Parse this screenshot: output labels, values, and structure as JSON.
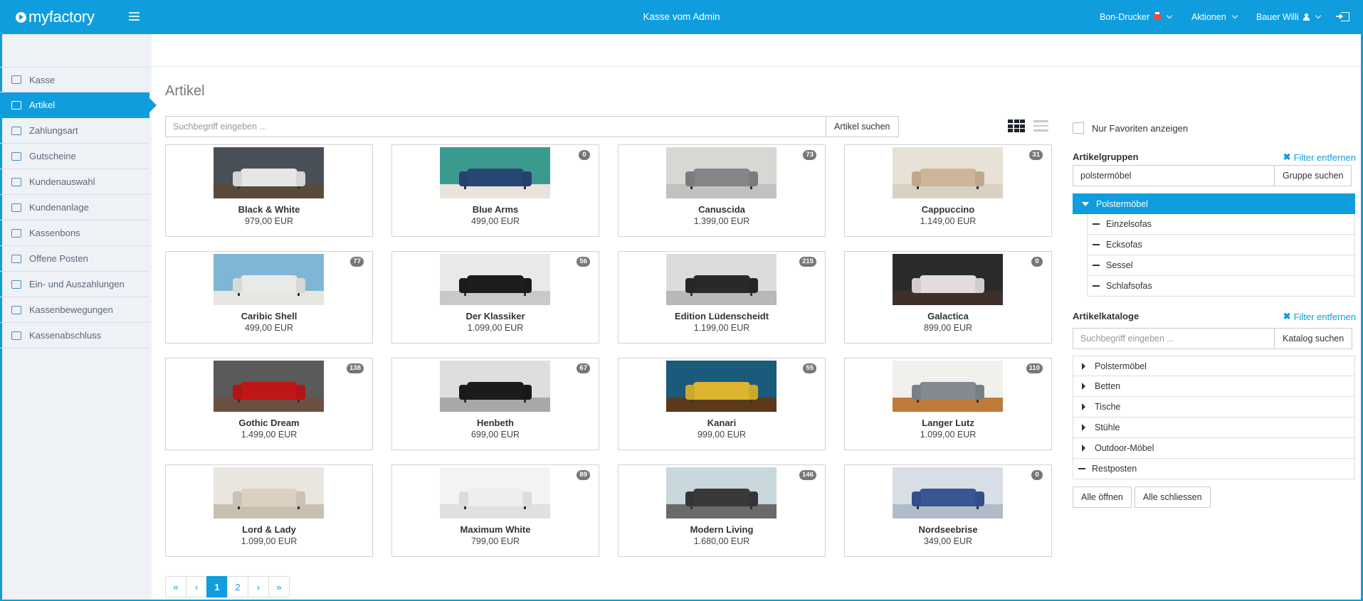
{
  "header": {
    "logo_text": "myfactory",
    "title": "Kasse vom Admin",
    "printer_label": "Bon-Drucker",
    "actions_label": "Aktionen",
    "user_label": "Bauer Willi"
  },
  "sidebar": {
    "items": [
      {
        "label": "Kasse",
        "icon": "cart-icon"
      },
      {
        "label": "Artikel",
        "icon": "tag-icon",
        "active": true
      },
      {
        "label": "Zahlungsart",
        "icon": "wallet-icon"
      },
      {
        "label": "Gutscheine",
        "icon": "gift-icon"
      },
      {
        "label": "Kundenauswahl",
        "icon": "user-icon"
      },
      {
        "label": "Kundenanlage",
        "icon": "user-add-icon"
      },
      {
        "label": "Kassenbons",
        "icon": "receipt-icon"
      },
      {
        "label": "Offene Posten",
        "icon": "book-icon"
      },
      {
        "label": "Ein- und Auszahlungen",
        "icon": "inbox-icon"
      },
      {
        "label": "Kassenbewegungen",
        "icon": "list-icon"
      },
      {
        "label": "Kassenabschluss",
        "icon": "calculator-icon"
      }
    ]
  },
  "main": {
    "title": "Artikel",
    "search_placeholder": "Suchbegriff eingeben ...",
    "search_button": "Artikel suchen",
    "products": [
      {
        "name": "Black & White",
        "price": "979,00 EUR",
        "badge": "",
        "wall": "#4a5058",
        "floor": "#5a4a3a",
        "sofa": "#f2f2f2"
      },
      {
        "name": "Blue Arms",
        "price": "499,00 EUR",
        "badge": "0",
        "wall": "#3a9a8e",
        "floor": "#e8e4dc",
        "sofa": "#2a4a7a"
      },
      {
        "name": "Canuscida",
        "price": "1.399,00 EUR",
        "badge": "73",
        "wall": "#d6d8d4",
        "floor": "#bfc2bf",
        "sofa": "#8a8c8e"
      },
      {
        "name": "Cappuccino",
        "price": "1.149,00 EUR",
        "badge": "31",
        "wall": "#e8e2d6",
        "floor": "#d9d1c3",
        "sofa": "#d8c0a0"
      },
      {
        "name": "Caribic Shell",
        "price": "499,00 EUR",
        "badge": "77",
        "wall": "#7fb6d6",
        "floor": "#e8e6e0",
        "sofa": "#f5f5f3"
      },
      {
        "name": "Der Klassiker",
        "price": "1.099,00 EUR",
        "badge": "56",
        "wall": "#e9e9e9",
        "floor": "#c9c9c9",
        "sofa": "#1f1f1f"
      },
      {
        "name": "Edition Lüdenscheidt",
        "price": "1.199,00 EUR",
        "badge": "215",
        "wall": "#dcdcdc",
        "floor": "#b8b8b8",
        "sofa": "#2b2b2b"
      },
      {
        "name": "Galactica",
        "price": "899,00 EUR",
        "badge": "0",
        "wall": "#2a2a2a",
        "floor": "#3d2f2a",
        "sofa": "#f0e8e8"
      },
      {
        "name": "Gothic Dream",
        "price": "1.499,00 EUR",
        "badge": "138",
        "wall": "#5a5a5a",
        "floor": "#6a5040",
        "sofa": "#c81818"
      },
      {
        "name": "Henbeth",
        "price": "699,00 EUR",
        "badge": "67",
        "wall": "#dedede",
        "floor": "#a8a8a8",
        "sofa": "#1c1c1c"
      },
      {
        "name": "Kanari",
        "price": "999,00 EUR",
        "badge": "55",
        "wall": "#1a5a7a",
        "floor": "#5a3a1a",
        "sofa": "#e8c030"
      },
      {
        "name": "Langer Lutz",
        "price": "1.099,00 EUR",
        "badge": "110",
        "wall": "#f2f0ec",
        "floor": "#c07a3a",
        "sofa": "#8a9098"
      },
      {
        "name": "Lord & Lady",
        "price": "1.099,00 EUR",
        "badge": "",
        "wall": "#e9e6e0",
        "floor": "#c8c0b0",
        "sofa": "#e6dccb"
      },
      {
        "name": "Maximum White",
        "price": "799,00 EUR",
        "badge": "89",
        "wall": "#f3f3f3",
        "floor": "#e0e0e0",
        "sofa": "#fafafa"
      },
      {
        "name": "Modern Living",
        "price": "1.680,00 EUR",
        "badge": "146",
        "wall": "#c8d8dc",
        "floor": "#6a6a6a",
        "sofa": "#3c3c3c"
      },
      {
        "name": "Nordseebrise",
        "price": "349,00 EUR",
        "badge": "0",
        "wall": "#d8dee6",
        "floor": "#b0bcc8",
        "sofa": "#3a5a9a"
      }
    ],
    "pagination": {
      "first": "«",
      "prev": "‹",
      "pages": [
        "1",
        "2"
      ],
      "current": "1",
      "next": "›",
      "last": "»"
    }
  },
  "filters": {
    "favorites_label": "Nur Favoriten anzeigen",
    "groups": {
      "title": "Artikelgruppen",
      "remove_label": "Filter entfernen",
      "search_value": "polstermöbel",
      "search_button": "Gruppe suchen",
      "selected": "Polstermöbel",
      "children": [
        "Einzelsofas",
        "Ecksofas",
        "Sessel",
        "Schlafsofas"
      ]
    },
    "catalogs": {
      "title": "Artikelkataloge",
      "remove_label": "Filter entfernen",
      "search_placeholder": "Suchbegriff eingeben ...",
      "search_button": "Katalog suchen",
      "items": [
        {
          "label": "Polstermöbel",
          "expandable": true
        },
        {
          "label": "Betten",
          "expandable": true
        },
        {
          "label": "Tische",
          "expandable": true
        },
        {
          "label": "Stühle",
          "expandable": true
        },
        {
          "label": "Outdoor-Möbel",
          "expandable": true
        },
        {
          "label": "Restposten",
          "expandable": false
        }
      ],
      "open_all": "Alle öffnen",
      "close_all": "Alle schliessen"
    }
  },
  "colors": {
    "accent": "#0f9ddd"
  }
}
